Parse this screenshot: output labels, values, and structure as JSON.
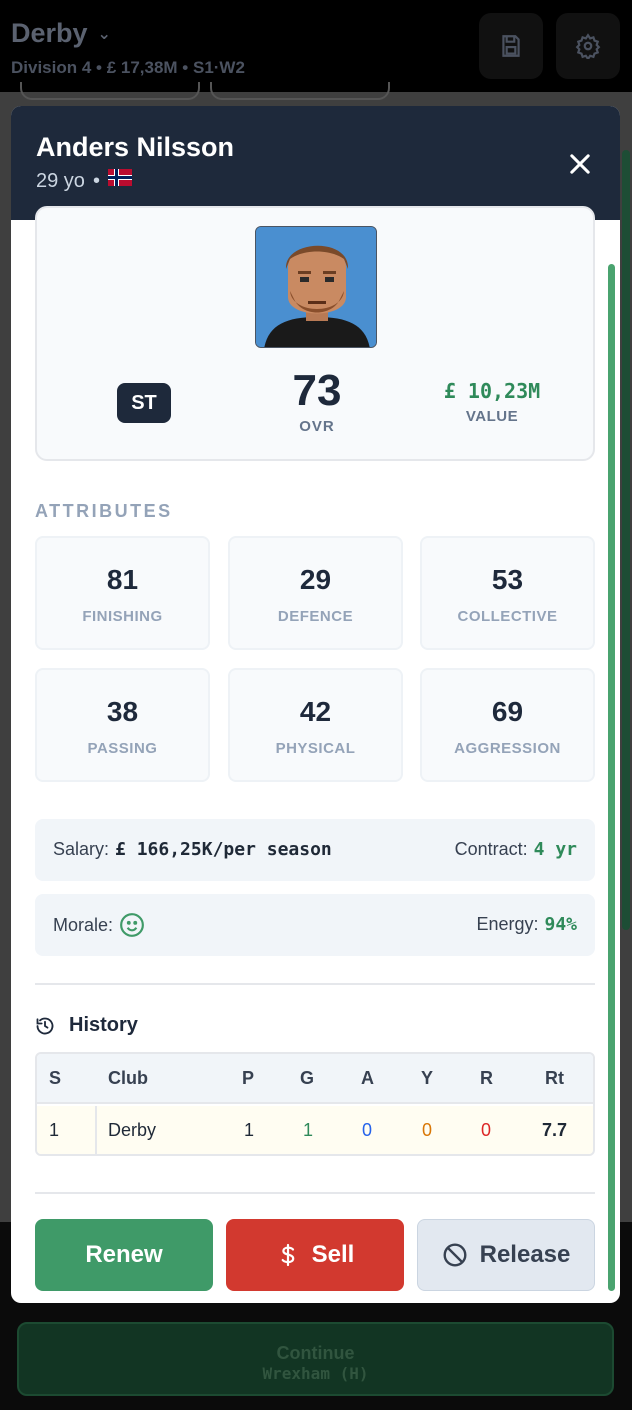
{
  "topbar": {
    "team": "Derby",
    "subtitle": "Division 4 • £ 17,38M • S1·W2"
  },
  "player": {
    "name": "Anders Nilsson",
    "age_text": "29 yo",
    "separator": "•",
    "position": "ST",
    "ovr": "73",
    "ovr_label": "OVR",
    "value": "£ 10,23M",
    "value_label": "VALUE"
  },
  "attributes": {
    "title": "ATTRIBUTES",
    "items": [
      {
        "value": "81",
        "label": "FINISHING"
      },
      {
        "value": "29",
        "label": "DEFENCE"
      },
      {
        "value": "53",
        "label": "COLLECTIVE"
      },
      {
        "value": "38",
        "label": "PASSING"
      },
      {
        "value": "42",
        "label": "PHYSICAL"
      },
      {
        "value": "69",
        "label": "AGGRESSION"
      }
    ]
  },
  "contract": {
    "salary_label": "Salary:",
    "salary_value": "£ 166,25K/per season",
    "contract_label": "Contract:",
    "contract_value": "4 yr"
  },
  "status": {
    "morale_label": "Morale:",
    "energy_label": "Energy:",
    "energy_value": "94%"
  },
  "history": {
    "title": "History",
    "columns": [
      "S",
      "Club",
      "P",
      "G",
      "A",
      "Y",
      "R",
      "Rt"
    ],
    "rows": [
      [
        "1",
        "Derby",
        "1",
        "1",
        "0",
        "0",
        "0",
        "7.7"
      ]
    ]
  },
  "actions": {
    "renew": "Renew",
    "sell": "Sell",
    "release": "Release"
  },
  "continue": {
    "label": "Continue",
    "next": "Wrexham (H)"
  },
  "colors": {
    "header": "#1e293b",
    "renew": "#3f9a68",
    "sell": "#d2392f",
    "goals": "#2f8a5a",
    "assists": "#2563eb",
    "yellow": "#d97706",
    "red": "#dc2626"
  }
}
